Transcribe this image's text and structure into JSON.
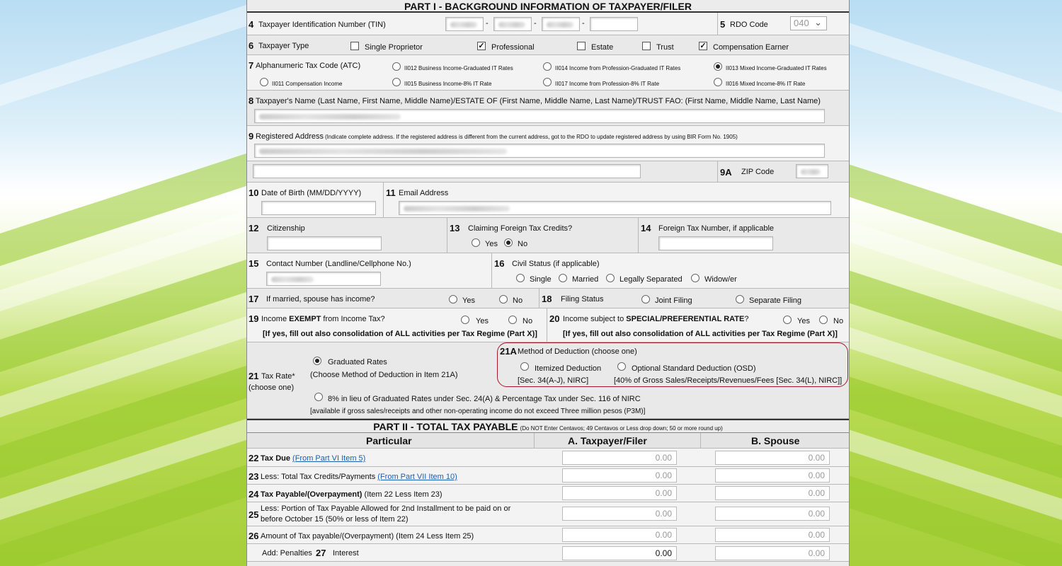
{
  "part1": {
    "title": "PART I - BACKGROUND INFORMATION OF TAXPAYER/FILER",
    "item4": {
      "num": "4",
      "label": "Taxpayer Identification Number (TIN)",
      "sep": "-"
    },
    "item5": {
      "num": "5",
      "label": "RDO Code",
      "value": "040"
    },
    "item6": {
      "num": "6",
      "label": "Taxpayer Type",
      "options": [
        {
          "label": "Single Proprietor",
          "checked": false
        },
        {
          "label": "Professional",
          "checked": true
        },
        {
          "label": "Estate",
          "checked": false
        },
        {
          "label": "Trust",
          "checked": false
        },
        {
          "label": "Compensation Earner",
          "checked": true
        }
      ]
    },
    "item7": {
      "num": "7",
      "label": "Alphanumeric Tax Code (ATC)",
      "options": [
        {
          "label": "II012 Business Income-Graduated IT Rates",
          "selected": false
        },
        {
          "label": "II014 Income from Profession-Graduated IT Rates",
          "selected": false
        },
        {
          "label": "II013 Mixed Income-Graduated IT Rates",
          "selected": true
        },
        {
          "label": "II011 Compensation Income",
          "selected": false
        },
        {
          "label": "II015 Business Income-8% IT Rate",
          "selected": false
        },
        {
          "label": "II017 Income from Profession-8% IT Rate",
          "selected": false
        },
        {
          "label": "II016 Mixed Income-8% IT Rate",
          "selected": false
        }
      ]
    },
    "item8": {
      "num": "8",
      "label": "Taxpayer's Name (Last Name, First Name, Middle Name)/ESTATE OF (First Name, Middle Name, Last Name)/TRUST FAO: (First Name, Middle Name, Last Name)"
    },
    "item9": {
      "num": "9",
      "label": "Registered Address",
      "note": "(Indicate complete address. If the registered address is different from the current address, got to the RDO to update registered address by using BIR Form No. 1905)"
    },
    "item9a": {
      "num": "9A",
      "label": "ZIP Code"
    },
    "item10": {
      "num": "10",
      "label": "Date of Birth (MM/DD/YYYY)"
    },
    "item11": {
      "num": "11",
      "label": "Email Address"
    },
    "item12": {
      "num": "12",
      "label": "Citizenship"
    },
    "item13": {
      "num": "13",
      "label": "Claiming Foreign Tax Credits?",
      "yes": "Yes",
      "no": "No",
      "selected": "No"
    },
    "item14": {
      "num": "14",
      "label": "Foreign Tax Number, if applicable"
    },
    "item15": {
      "num": "15",
      "label": "Contact Number (Landline/Cellphone No.)"
    },
    "item16": {
      "num": "16",
      "label": "Civil Status (if applicable)",
      "options": [
        "Single",
        "Married",
        "Legally Separated",
        "Widow/er"
      ]
    },
    "item17": {
      "num": "17",
      "label": "If married, spouse has income?",
      "yes": "Yes",
      "no": "No"
    },
    "item18": {
      "num": "18",
      "label": "Filing Status",
      "options": [
        "Joint Filing",
        "Separate Filing"
      ]
    },
    "item19": {
      "num": "19",
      "label_pre": "Income ",
      "label_bold": "EXEMPT",
      "label_post": " from Income Tax?",
      "yes": "Yes",
      "no": "No",
      "note": "[If yes, fill out also consolidation of ALL activities per Tax Regime (Part X)]"
    },
    "item20": {
      "num": "20",
      "label_pre": "Income subject to ",
      "label_bold": "SPECIAL/PREFERENTIAL RATE",
      "label_post": "?",
      "yes": "Yes",
      "no": "No",
      "note": "[If yes, fill out also consolidation of ALL activities per Tax Regime (Part X)]"
    },
    "item21": {
      "num": "21",
      "label": "Tax Rate*",
      "sub": "(choose one)",
      "graduated": "Graduated Rates",
      "graduated_note": "(Choose Method of Deduction in Item 21A)",
      "eight": "8% in lieu of Graduated Rates under Sec. 24(A) & Percentage Tax under Sec. 116 of NIRC",
      "eight_note": "[available if gross sales/receipts and other non-operating income do not exceed Three million pesos (P3M)]"
    },
    "item21a": {
      "num": "21A",
      "label": "Method of Deduction (choose one)",
      "itemized": "Itemized Deduction",
      "itemized_note": "[Sec. 34(A-J), NIRC]",
      "osd": "Optional Standard Deduction (OSD)",
      "osd_note": "[40% of Gross Sales/Receipts/Revenues/Fees [Sec. 34(L), NIRC]]"
    }
  },
  "part2": {
    "title": "PART II - TOTAL TAX PAYABLE",
    "title_note": "(Do NOT Enter Centavos; 49 Centavos or Less drop down; 50 or more round up)",
    "col_particular": "Particular",
    "col_a": "A. Taxpayer/Filer",
    "col_b": "B. Spouse",
    "rows": [
      {
        "num": "22",
        "label_bold": "Tax Due",
        "label": " ",
        "link": "(From Part VI Item 5)",
        "a": "0.00",
        "b": "0.00"
      },
      {
        "num": "23",
        "label": "Less: Total Tax Credits/Payments ",
        "link": "(From Part VII Item 10)",
        "a": "0.00",
        "b": "0.00"
      },
      {
        "num": "24",
        "label_bold": "Tax Payable/(Overpayment)",
        "label": " (Item 22 Less Item 23)",
        "a": "0.00",
        "b": "0.00"
      },
      {
        "num": "25",
        "label": "Less: Portion of Tax Payable Allowed for 2nd Installment to be paid on or",
        "label2": "before October 15 (50% or less of Item 22)",
        "a": "0.00",
        "b": "0.00"
      },
      {
        "num": "26",
        "label": "Amount of Tax payable/(Overpayment) (Item 24 Less Item 25)",
        "a": "0.00",
        "b": "0.00"
      },
      {
        "num": "27",
        "pre": "Add: Penalties",
        "label": "Interest",
        "a": "0.00",
        "b": "0.00"
      }
    ]
  }
}
